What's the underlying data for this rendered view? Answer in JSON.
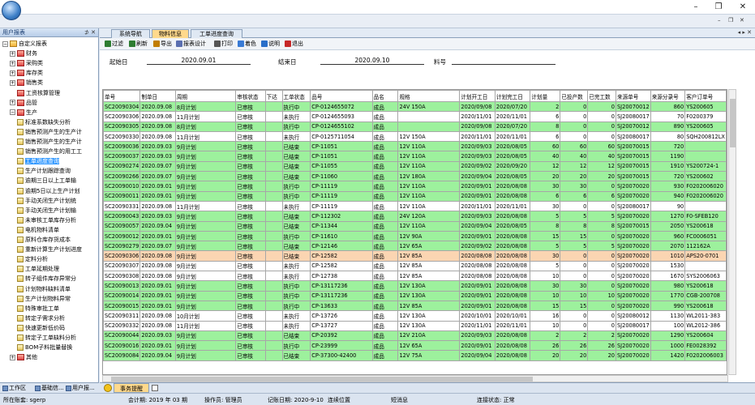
{
  "window": {
    "min_label": "–",
    "restore_label": "❐",
    "close_label": "✕"
  },
  "left_panel": {
    "title": "用户报表",
    "pin_label": "⊅ ✕",
    "tree": [
      {
        "label": "自定义报表",
        "level": 0,
        "exp": "−",
        "icon": "ficon"
      },
      {
        "label": "财务",
        "level": 1,
        "exp": "+",
        "icon": "ficon red"
      },
      {
        "label": "采购类",
        "level": 1,
        "exp": "+",
        "icon": "ficon red"
      },
      {
        "label": "库存类",
        "level": 1,
        "exp": "+",
        "icon": "ficon red"
      },
      {
        "label": "销售类",
        "level": 1,
        "exp": "+",
        "icon": "ficon red"
      },
      {
        "label": "工资核算管理",
        "level": 1,
        "exp": "",
        "icon": "ficon red"
      },
      {
        "label": "品管",
        "level": 1,
        "exp": "+",
        "icon": "ficon red"
      },
      {
        "label": "生产",
        "level": 1,
        "exp": "−",
        "icon": "ficon red"
      },
      {
        "label": "标准系数缺失分析",
        "level": 2,
        "icon": "ficon doc"
      },
      {
        "label": "销售预测产生的生产计",
        "level": 2,
        "icon": "ficon doc"
      },
      {
        "label": "销售预测产生的生产计",
        "level": 2,
        "icon": "ficon doc"
      },
      {
        "label": "销售预测产生的用工工",
        "level": 2,
        "icon": "ficon doc"
      },
      {
        "label": "工单进度查询",
        "level": 2,
        "icon": "ficon doc",
        "selected": true
      },
      {
        "label": "生产计划跟踪查询",
        "level": 2,
        "icon": "ficon doc"
      },
      {
        "label": "逾期三日以上工单输",
        "level": 2,
        "icon": "ficon doc"
      },
      {
        "label": "逾期5日以上生产计划",
        "level": 2,
        "icon": "ficon doc"
      },
      {
        "label": "手动关闭生产计划统",
        "level": 2,
        "icon": "ficon doc"
      },
      {
        "label": "手动关闭生产计划输",
        "level": 2,
        "icon": "ficon doc"
      },
      {
        "label": "未审核工单库存分析",
        "level": 2,
        "icon": "ficon doc"
      },
      {
        "label": "电机物料清单",
        "level": 2,
        "icon": "ficon doc"
      },
      {
        "label": "原料仓库存货成本",
        "level": 2,
        "icon": "ficon doc"
      },
      {
        "label": "重新计算生产计划进度",
        "level": 2,
        "icon": "ficon doc"
      },
      {
        "label": "定料分析",
        "level": 2,
        "icon": "ficon doc"
      },
      {
        "label": "工单延期处理",
        "level": 2,
        "icon": "ficon doc"
      },
      {
        "label": "转子组件库存异常分",
        "level": 2,
        "icon": "ficon doc"
      },
      {
        "label": "计划物料缺料清单",
        "level": 2,
        "icon": "ficon doc"
      },
      {
        "label": "生产计划物料异常",
        "level": 2,
        "icon": "ficon doc"
      },
      {
        "label": "特殊审批工单",
        "level": 2,
        "icon": "ficon doc"
      },
      {
        "label": "转定子需求分析",
        "level": 2,
        "icon": "ficon doc"
      },
      {
        "label": "快速更新低价码",
        "level": 2,
        "icon": "ficon doc"
      },
      {
        "label": "转定子工单缺料分析",
        "level": 2,
        "icon": "ficon doc"
      },
      {
        "label": "BOM子料批量替换",
        "level": 2,
        "icon": "ficon doc"
      },
      {
        "label": "其他",
        "level": 1,
        "exp": "+",
        "icon": "ficon red"
      }
    ],
    "bottom_tabs": [
      "工作区",
      "基础信...",
      "用户报..."
    ]
  },
  "doc_tabs": [
    {
      "label": "系统导航",
      "active": false
    },
    {
      "label": "物料信息",
      "active": true
    },
    {
      "label": "工单进度查询",
      "active": false
    }
  ],
  "tab_arrows": "◂ ▸ ✕",
  "toolbar": [
    {
      "label": "过滤",
      "icon": "filter-icon",
      "color": "#2e7d32"
    },
    {
      "label": "刷新",
      "icon": "refresh-icon",
      "color": "#2e7d32"
    },
    {
      "label": "导出",
      "icon": "export-icon",
      "color": "#c17d00"
    },
    {
      "label": "报表设计",
      "icon": "design-icon",
      "color": "#5a6fb0"
    },
    {
      "label": "打印",
      "icon": "print-icon",
      "color": "#555555"
    },
    {
      "label": "着色",
      "icon": "color-icon",
      "color": "#3a7bd5"
    },
    {
      "label": "说明",
      "icon": "info-icon",
      "color": "#2a6fc9"
    },
    {
      "label": "退出",
      "icon": "exit-icon",
      "color": "#c62828"
    }
  ],
  "params": {
    "start_label": "起始日",
    "start_value": "2020.09.01",
    "end_label": "结束日",
    "end_value": "2020.09.10",
    "item_label": "料号",
    "item_value": ""
  },
  "columns": [
    "单号",
    "制单日",
    "周期",
    "审核状态",
    "下达",
    "工单状态",
    "品号",
    "品名",
    "规格",
    "计划开工日",
    "计划完工日",
    "计划量",
    "已投产数",
    "已完工数",
    "来源单号",
    "来源分录号",
    "客户订单号"
  ],
  "rows": [
    {
      "c": "g",
      "v": [
        "SC20090304",
        "2020.09.08",
        "8月计划",
        "已审核",
        "",
        "执行中",
        "CP-0124655072",
        "成品",
        "24V 150A",
        "2020/09/08",
        "2020/07/20",
        "2",
        "0",
        "0",
        "SJ20070012",
        "860",
        "YS200605"
      ]
    },
    {
      "c": "w",
      "v": [
        "SC20090306",
        "2020.09.08",
        "11月计划",
        "已审核",
        "",
        "未执行",
        "CP-0124655093",
        "成品",
        "",
        "2020/11/01",
        "2020/11/01",
        "6",
        "0",
        "0",
        "SJ20080017",
        "70",
        "F0200379"
      ]
    },
    {
      "c": "g",
      "v": [
        "SC20090305",
        "2020.09.08",
        "8月计划",
        "已审核",
        "",
        "执行中",
        "CP-0124655102",
        "成品",
        "",
        "2020/09/08",
        "2020/07/20",
        "8",
        "0",
        "0",
        "SJ20070012",
        "890",
        "YS200605"
      ]
    },
    {
      "c": "w",
      "v": [
        "SC20090330",
        "2020.09.08",
        "11月计划",
        "已审核",
        "",
        "未执行",
        "CP-0125711054",
        "成品",
        "12V 150A",
        "2020/11/01",
        "2020/11/01",
        "6",
        "0",
        "0",
        "SJ20080017",
        "80",
        "SQH200812LX"
      ]
    },
    {
      "c": "g",
      "v": [
        "SC20090036",
        "2020.09.03",
        "9月计划",
        "已审核",
        "",
        "已结束",
        "CP-11051",
        "成品",
        "12V 110A",
        "2020/09/03",
        "2020/08/05",
        "60",
        "60",
        "60",
        "SJ20070015",
        "720",
        ""
      ]
    },
    {
      "c": "g",
      "v": [
        "SC20090037",
        "2020.09.03",
        "9月计划",
        "已审核",
        "",
        "已结束",
        "CP-11051",
        "成品",
        "12V 110A",
        "2020/09/03",
        "2020/08/05",
        "40",
        "40",
        "40",
        "SJ20070015",
        "1190",
        ""
      ]
    },
    {
      "c": "g",
      "v": [
        "SC20090274",
        "2020.09.07",
        "9月计划",
        "已审核",
        "",
        "已结束",
        "CP-11055",
        "成品",
        "12V 110A",
        "2020/09/02",
        "2020/09/20",
        "12",
        "12",
        "12",
        "SJ20070015",
        "1910",
        "YS200724-1"
      ]
    },
    {
      "c": "g",
      "v": [
        "SC20090266",
        "2020.09.07",
        "9月计划",
        "已审核",
        "",
        "已结束",
        "CP-11060",
        "成品",
        "12V 180A",
        "2020/09/04",
        "2020/08/05",
        "20",
        "20",
        "20",
        "SJ20070015",
        "720",
        "YS200602"
      ]
    },
    {
      "c": "g",
      "v": [
        "SC20090010",
        "2020.09.01",
        "9月计划",
        "已审核",
        "",
        "执行中",
        "CP-11119",
        "成品",
        "12V 110A",
        "2020/09/01",
        "2020/08/08",
        "30",
        "30",
        "0",
        "SJ20070020",
        "930",
        "F0202006020"
      ]
    },
    {
      "c": "g",
      "v": [
        "SC20090011",
        "2020.09.01",
        "9月计划",
        "已审核",
        "",
        "执行中",
        "CP-11119",
        "成品",
        "12V 110A",
        "2020/09/01",
        "2020/08/08",
        "6",
        "6",
        "6",
        "SJ20070020",
        "940",
        "F0202006020"
      ]
    },
    {
      "c": "w",
      "v": [
        "SC20090331",
        "2020.09.08",
        "11月计划",
        "已审核",
        "",
        "未执行",
        "CP-11119",
        "成品",
        "12V 110A",
        "2020/11/01",
        "2020/11/01",
        "30",
        "0",
        "0",
        "SJ20080017",
        "90",
        ""
      ]
    },
    {
      "c": "g",
      "v": [
        "SC20090043",
        "2020.09.03",
        "9月计划",
        "已审核",
        "",
        "已结束",
        "CP-112302",
        "成品",
        "24V 120A",
        "2020/09/03",
        "2020/08/08",
        "5",
        "5",
        "5",
        "SJ20070020",
        "1270",
        "F0-SFEB120"
      ]
    },
    {
      "c": "g",
      "v": [
        "SC20090057",
        "2020.09.04",
        "9月计划",
        "已审核",
        "",
        "已结束",
        "CP-11344",
        "成品",
        "12V 110A",
        "2020/09/04",
        "2020/08/05",
        "8",
        "8",
        "8",
        "SJ20070015",
        "2050",
        "YS200618"
      ]
    },
    {
      "c": "g",
      "v": [
        "SC20090012",
        "2020.09.01",
        "9月计划",
        "已审核",
        "",
        "执行中",
        "CP-11610",
        "成品",
        "12V 90A",
        "2020/09/01",
        "2020/08/08",
        "15",
        "15",
        "0",
        "SJ20070020",
        "960",
        "FC0006051"
      ]
    },
    {
      "c": "g",
      "v": [
        "SC20090279",
        "2020.09.07",
        "9月计划",
        "已审核",
        "",
        "已结束",
        "CP-12146",
        "成品",
        "12V 65A",
        "2020/09/02",
        "2020/08/08",
        "5",
        "5",
        "5",
        "SJ20070020",
        "2070",
        "112162A"
      ]
    },
    {
      "c": "o",
      "v": [
        "SC20090306",
        "2020.09.08",
        "9月计划",
        "已审核",
        "",
        "已结束",
        "CP-12582",
        "成品",
        "12V 85A",
        "2020/08/08",
        "2020/08/08",
        "30",
        "0",
        "0",
        "SJ20070020",
        "1010",
        "APS20-0701"
      ]
    },
    {
      "c": "w",
      "v": [
        "SC20090307",
        "2020.09.08",
        "9月计划",
        "已审核",
        "",
        "未执行",
        "CP-12582",
        "成品",
        "12V 85A",
        "2020/08/08",
        "2020/08/08",
        "5",
        "0",
        "0",
        "SJ20070020",
        "1530",
        ""
      ]
    },
    {
      "c": "w",
      "v": [
        "SC20090308",
        "2020.09.08",
        "9月计划",
        "已审核",
        "",
        "未执行",
        "CP-12738",
        "成品",
        "12V 85A",
        "2020/08/08",
        "2020/08/08",
        "10",
        "0",
        "0",
        "SJ20070020",
        "1670",
        "SYS2006063"
      ]
    },
    {
      "c": "g",
      "v": [
        "SC20090013",
        "2020.09.01",
        "9月计划",
        "已审核",
        "",
        "执行中",
        "CP-13117236",
        "成品",
        "12V 130A",
        "2020/09/01",
        "2020/08/08",
        "30",
        "30",
        "0",
        "SJ20070020",
        "980",
        "YS200618"
      ]
    },
    {
      "c": "g",
      "v": [
        "SC20090014",
        "2020.09.01",
        "9月计划",
        "已审核",
        "",
        "执行中",
        "CP-13117236",
        "成品",
        "12V 130A",
        "2020/09/01",
        "2020/08/08",
        "10",
        "10",
        "10",
        "SJ20070020",
        "1770",
        "CGB-200708"
      ]
    },
    {
      "c": "g",
      "v": [
        "SC20090015",
        "2020.09.01",
        "9月计划",
        "已审核",
        "",
        "执行中",
        "CP-13633",
        "成品",
        "12V 85A",
        "2020/09/01",
        "2020/08/08",
        "15",
        "15",
        "0",
        "SJ20070020",
        "990",
        "YS200618"
      ]
    },
    {
      "c": "w",
      "v": [
        "SC20090311",
        "2020.09.08",
        "10月计划",
        "已审核",
        "",
        "未执行",
        "CP-13726",
        "成品",
        "12V 130A",
        "2020/10/01",
        "2020/10/01",
        "16",
        "0",
        "0",
        "SJ20080012",
        "1130",
        "WL2011-383"
      ]
    },
    {
      "c": "w",
      "v": [
        "SC20090332",
        "2020.09.08",
        "11月计划",
        "已审核",
        "",
        "未执行",
        "CP-13727",
        "成品",
        "12V 130A",
        "2020/11/01",
        "2020/11/01",
        "10",
        "0",
        "0",
        "SJ20080017",
        "100",
        "WL2012-386"
      ]
    },
    {
      "c": "g",
      "v": [
        "SC20090044",
        "2020.09.03",
        "9月计划",
        "已审核",
        "",
        "已结束",
        "CP-20392",
        "成品",
        "12V 210A",
        "2020/09/03",
        "2020/08/08",
        "2",
        "2",
        "2",
        "SJ20070020",
        "1290",
        "YS200604"
      ]
    },
    {
      "c": "g",
      "v": [
        "SC20090016",
        "2020.09.01",
        "9月计划",
        "已审核",
        "",
        "执行中",
        "CP-23999",
        "成品",
        "12V 65A",
        "2020/09/01",
        "2020/08/08",
        "26",
        "26",
        "26",
        "SJ20070020",
        "1000",
        "FE0028392"
      ]
    },
    {
      "c": "g",
      "v": [
        "SC20090084",
        "2020.09.04",
        "9月计划",
        "已审核",
        "",
        "已结束",
        "CP-37300-42400",
        "成品",
        "12V 75A",
        "2020/09/04",
        "2020/08/08",
        "20",
        "20",
        "20",
        "SJ20070020",
        "1420",
        "F0202006003"
      ]
    }
  ],
  "bottom_tab": "事务提醒",
  "status": {
    "user_label": "所在账套: sgerp",
    "period_label": "会计期: 2019 年 03 期",
    "operator_label": "操作员: 管理员",
    "date_label": "记账日期: 2020-9-10",
    "online_label": "连续位置",
    "msg_label": "短消息",
    "conn_label": "连接状态: 正常"
  }
}
